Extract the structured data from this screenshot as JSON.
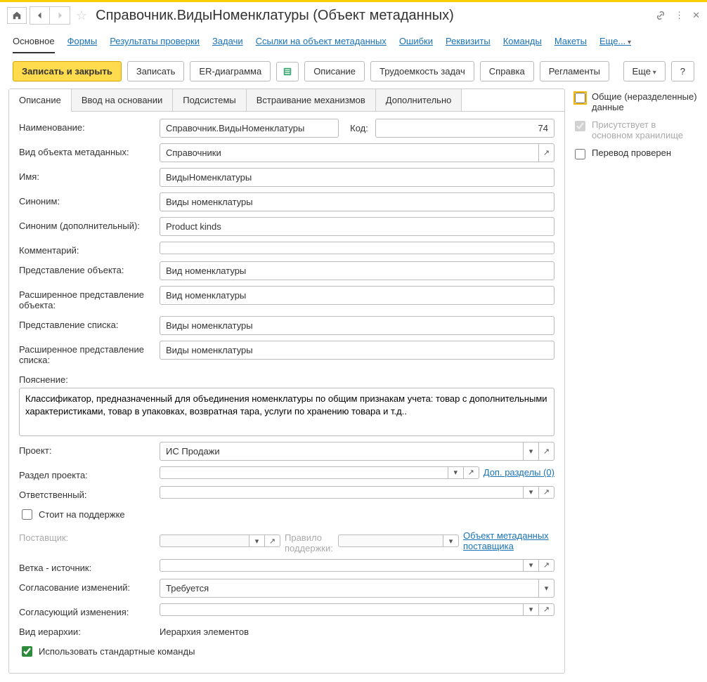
{
  "title": "Справочник.ВидыНоменклатуры (Объект метаданных)",
  "nav_tabs": {
    "main": "Основное",
    "forms": "Формы",
    "check_results": "Результаты проверки",
    "tasks": "Задачи",
    "meta_links": "Ссылки на объект метаданных",
    "errors": "Ошибки",
    "requisites": "Реквизиты",
    "commands": "Команды",
    "layouts": "Макеты",
    "more": "Еще..."
  },
  "toolbar": {
    "save_close": "Записать и закрыть",
    "save": "Записать",
    "er_diagram": "ER-диаграмма",
    "description": "Описание",
    "difficulty": "Трудоемкость задач",
    "help": "Справка",
    "regulations": "Регламенты",
    "more": "Еще",
    "question": "?"
  },
  "inner_tabs": {
    "description": "Описание",
    "input_based": "Ввод на основании",
    "subsystems": "Подсистемы",
    "mechanisms": "Встраивание механизмов",
    "additional": "Дополнительно"
  },
  "labels": {
    "name_full": "Наименование:",
    "code": "Код:",
    "meta_kind": "Вид объекта метаданных:",
    "name": "Имя:",
    "synonym": "Синоним:",
    "synonym_add": "Синоним (дополнительный):",
    "comment": "Комментарий:",
    "obj_repr": "Представление объекта:",
    "obj_repr_ext": "Расширенное представление объекта:",
    "list_repr": "Представление списка:",
    "list_repr_ext": "Расширенное представление списка:",
    "explanation": "Пояснение:",
    "project": "Проект:",
    "project_section": "Раздел проекта:",
    "add_sections": "Доп. разделы (0)",
    "responsible": "Ответственный:",
    "on_support": "Стоит на поддержке",
    "supplier": "Поставщик:",
    "support_rule": "Правило поддержки:",
    "supplier_meta": "Объект метаданных поставщика",
    "branch_source": "Ветка - источник:",
    "change_approval": "Согласование изменений:",
    "change_approver": "Согласующий изменения:",
    "hierarchy_kind": "Вид иерархии:",
    "use_std_commands": "Использовать стандартные команды"
  },
  "values": {
    "name_full": "Справочник.ВидыНоменклатуры",
    "code": "74",
    "meta_kind": "Справочники",
    "name": "ВидыНоменклатуры",
    "synonym": "Виды номенклатуры",
    "synonym_add": "Product kinds",
    "comment": "",
    "obj_repr": "Вид номенклатуры",
    "obj_repr_ext": "Вид номенклатуры",
    "list_repr": "Виды номенклатуры",
    "list_repr_ext": "Виды номенклатуры",
    "explanation": "Классификатор, предназначенный для объединения номенклатуры по общим признакам учета: товар с дополнительными характеристиками, товар в упаковках, возвратная тара, услуги по хранению товара и т.д..",
    "project": "ИС Продажи",
    "project_section": "",
    "responsible": "",
    "supplier": "",
    "support_rule": "",
    "branch_source": "",
    "change_approval": "Требуется",
    "change_approver": "",
    "hierarchy_kind": "Иерархия элементов"
  },
  "sidebar": {
    "shared_data": "Общие (неразделенные) данные",
    "in_main_storage": "Присутствует в основном хранилище",
    "translation_checked": "Перевод проверен"
  }
}
